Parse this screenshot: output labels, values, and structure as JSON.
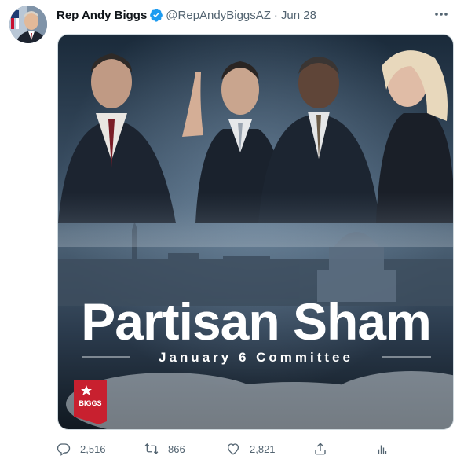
{
  "tweet": {
    "author_name": "Rep Andy Biggs",
    "handle": "@RepAndyBiggsAZ",
    "separator": "·",
    "date": "Jun 28",
    "verified": true
  },
  "media": {
    "headline": "Partisan Sham",
    "subhead": "January 6 Committee",
    "logo_text": "BIGGS"
  },
  "actions": {
    "replies": "2,516",
    "retweets": "866",
    "likes": "2,821"
  },
  "colors": {
    "accent": "#1d9bf0",
    "muted": "#536471",
    "logo_red": "#c8202f"
  },
  "icons": {
    "verified": "verified-badge-icon",
    "more": "more-horizontal-icon",
    "reply": "reply-icon",
    "retweet": "retweet-icon",
    "like": "heart-icon",
    "share": "share-icon",
    "analytics": "analytics-icon"
  }
}
